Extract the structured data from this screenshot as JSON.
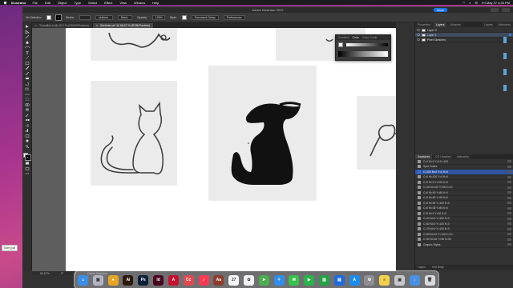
{
  "menubar": {
    "app_name": "Illustrator",
    "menus": [
      "File",
      "Edit",
      "Object",
      "Type",
      "Select",
      "Effect",
      "View",
      "Window",
      "Help"
    ],
    "clock": "Fri May 27  4:33 PM"
  },
  "window": {
    "title": "Adobe Illustrator 2022",
    "share_label": "Share"
  },
  "control_bar": {
    "selection_label": "No Selection",
    "stroke_label": "Stroke:",
    "stroke_value": "",
    "variable_width": "Uniform",
    "brush": "Basic",
    "opacity_label": "Opacity:",
    "opacity_value": "100%",
    "style_label": "Style:",
    "document_setup": "Document Setup",
    "preferences": "Preferences"
  },
  "doc_tabs": [
    {
      "label": "Tornaflick.ai @ 45.2 % (CMYK/Preview)",
      "active": false
    },
    {
      "label": "Sketches.ai* @ 66.67 % (RGB/Preview)",
      "active": true
    }
  ],
  "status_bar": {
    "zoom": "66.67%",
    "rotation": "0°",
    "artboard": "1",
    "tool": "Direct Selection"
  },
  "color_panel": {
    "tabs": [
      "Gradient",
      "Color",
      "Color Guide"
    ],
    "active_tab": "Color"
  },
  "right_panel": {
    "tabs": [
      "Properties",
      "Layers",
      "Libraries"
    ],
    "active_tab": "Layers",
    "side_tabs": [
      "Layers",
      "Artboards"
    ],
    "layers": [
      {
        "name": "Layer 3",
        "selected": false
      },
      {
        "name": "Layer 1",
        "selected": true
      },
      {
        "name": "Pixel Sketches",
        "selected": false
      }
    ],
    "lower_tabs": [
      "Swatches",
      "CC Libraries",
      "Artboards"
    ],
    "swatches": [
      {
        "label": "C=0 M=0 Y=0 K=100",
        "selected": false
      },
      {
        "label": "Spot Colors",
        "selected": false
      },
      {
        "label": "C=100 M=0 Y=0 K=0",
        "selected": true
      },
      {
        "label": "C=0 M=100 Y=0 K=0",
        "selected": false
      },
      {
        "label": "C=0 M=0 Y=100 K=0",
        "selected": false
      },
      {
        "label": "C=15 M=100 Y=90 K=10",
        "selected": false
      },
      {
        "label": "C=0 M=90 Y=85 K=0",
        "selected": false
      },
      {
        "label": "C=0 M=80 Y=95 K=0",
        "selected": false
      },
      {
        "label": "C=0 M=50 Y=100 K=0",
        "selected": false
      },
      {
        "label": "C=0 M=35 Y=85 K=0",
        "selected": false
      },
      {
        "label": "C=5 M=0 Y=90 K=0",
        "selected": false
      },
      {
        "label": "C=20 M=0 Y=100 K=0",
        "selected": false
      },
      {
        "label": "C=50 M=0 Y=100 K=0",
        "selected": false
      },
      {
        "label": "C=75 M=0 Y=100 K=0",
        "selected": false
      },
      {
        "label": "C=85 M=10 Y=100 K=10",
        "selected": false
      },
      {
        "label": "C=90 M=30 Y=95 K=30",
        "selected": false
      },
      {
        "label": "Graphic Styles",
        "selected": false
      }
    ],
    "footer": [
      "Layers",
      "Text Wrap"
    ]
  },
  "sticky_notes": [
    "Sorry pal",
    "Sorry pal",
    "Sorry pal"
  ],
  "dock_apps": [
    {
      "name": "Finder",
      "glyph": "☺",
      "color": "#3b8ee6"
    },
    {
      "name": "Launchpad",
      "glyph": "▦",
      "color": "#b4b4c4"
    },
    {
      "name": "Chrome",
      "glyph": "●",
      "color": "#e7a623"
    },
    {
      "name": "Illustrator",
      "glyph": "Ai",
      "color": "#2b1a0a"
    },
    {
      "name": "Photoshop",
      "glyph": "Ps",
      "color": "#0a1f3a"
    },
    {
      "name": "InDesign",
      "glyph": "Id",
      "color": "#49021f"
    },
    {
      "name": "Acrobat",
      "glyph": "A",
      "color": "#c8102e"
    },
    {
      "name": "Adobe CC",
      "glyph": "Cc",
      "color": "#e34850"
    },
    {
      "name": "Music",
      "glyph": "♪",
      "color": "#fa3a54"
    },
    {
      "name": "Dictionary",
      "glyph": "Aa",
      "color": "#8d3d2b"
    },
    {
      "name": "Calendar",
      "glyph": "27",
      "color": "#f5f5f5"
    },
    {
      "name": "Photos",
      "glyph": "✿",
      "color": "#f2f2f2"
    },
    {
      "name": "Maps",
      "glyph": "➤",
      "color": "#4cae4f"
    },
    {
      "name": "Safari",
      "glyph": "✧",
      "color": "#2f8ee8"
    },
    {
      "name": "Messages",
      "glyph": "✉",
      "color": "#36c24b"
    },
    {
      "name": "FaceTime",
      "glyph": "▶",
      "color": "#28b44a"
    },
    {
      "name": "Numbers",
      "glyph": "▥",
      "color": "#24a147"
    },
    {
      "name": "Keynote",
      "glyph": "▤",
      "color": "#1f6ae0"
    },
    {
      "name": "App Store",
      "glyph": "A",
      "color": "#1a8cf0"
    },
    {
      "name": "Settings",
      "glyph": "⚙",
      "color": "#8e8e93"
    },
    {
      "name": "Notes",
      "glyph": "≡",
      "color": "#f4d24b"
    },
    {
      "name": "Preview",
      "glyph": "▣",
      "color": "#c7c7cc"
    },
    {
      "name": "Downloads",
      "glyph": "↓",
      "color": "#4a90e2"
    },
    {
      "name": "Trash",
      "glyph": "🗑",
      "color": "#d9d9de"
    }
  ]
}
